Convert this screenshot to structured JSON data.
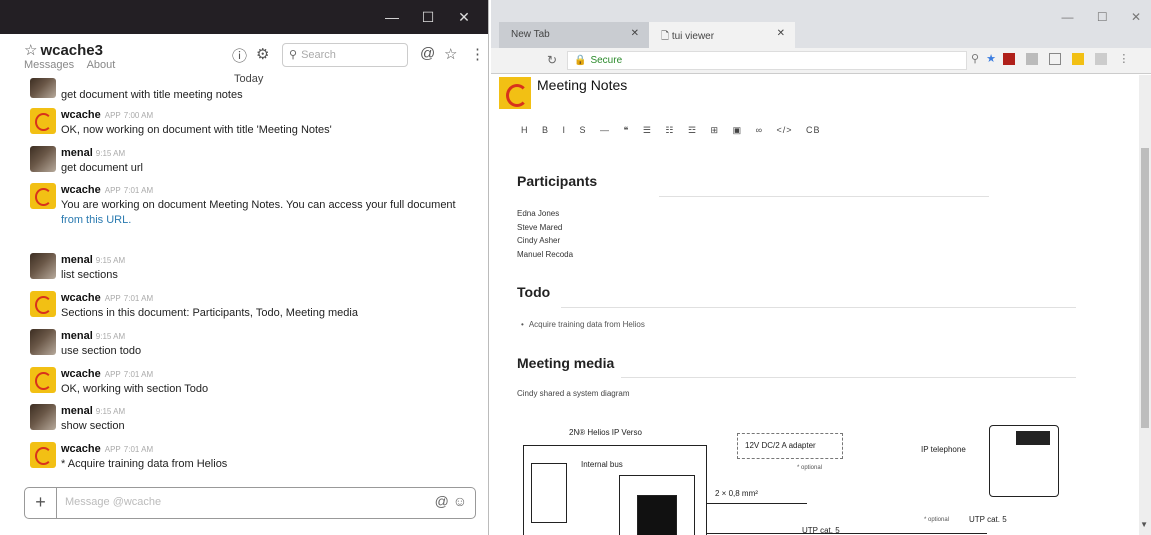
{
  "chat": {
    "channel_name": "wcache3",
    "tabs": [
      "Messages",
      "About"
    ],
    "search_placeholder": "Search",
    "day_divider": "Today",
    "composer_placeholder": "Message @wcache",
    "messages": [
      {
        "kind": "human",
        "name": "",
        "time": "",
        "text": "get document with title meeting notes"
      },
      {
        "kind": "bot",
        "name": "wcache",
        "app": "APP",
        "time": "7:00 AM",
        "text": "OK, now working on document with title 'Meeting Notes'"
      },
      {
        "kind": "human",
        "name": "menal",
        "time": "9:15 AM",
        "text": "get document url"
      },
      {
        "kind": "bot",
        "name": "wcache",
        "app": "APP",
        "time": "7:01 AM",
        "text": "You are working on document Meeting Notes. You can access your full document",
        "link": "from this URL."
      },
      {
        "kind": "human",
        "name": "menal",
        "time": "9:15 AM",
        "text": "list sections"
      },
      {
        "kind": "bot",
        "name": "wcache",
        "app": "APP",
        "time": "7:01 AM",
        "text": "Sections in this document: Participants, Todo, Meeting media"
      },
      {
        "kind": "human",
        "name": "menal",
        "time": "9:15 AM",
        "text": "use section todo"
      },
      {
        "kind": "bot",
        "name": "wcache",
        "app": "APP",
        "time": "7:01 AM",
        "text": "OK, working with section Todo"
      },
      {
        "kind": "human",
        "name": "menal",
        "time": "9:15 AM",
        "text": "show section"
      },
      {
        "kind": "bot",
        "name": "wcache",
        "app": "APP",
        "time": "7:01 AM",
        "text": "* Acquire training data from Helios"
      }
    ]
  },
  "browser": {
    "tabs": [
      {
        "label": "New Tab"
      },
      {
        "label": "tui viewer"
      }
    ],
    "url_label": "Secure",
    "doc": {
      "title": "Meeting Notes",
      "toolbar": "H B I S — ❝ ☰ ☷ ☲ ⊞ ▣ ∞ </> CB",
      "sections": [
        {
          "heading": "Participants",
          "items": [
            "Edna Jones",
            "Steve Mared",
            "Cindy Asher",
            "Manuel Recoda"
          ]
        },
        {
          "heading": "Todo",
          "items": [
            "Acquire training data from Helios"
          ]
        },
        {
          "heading": "Meeting media",
          "items": [
            "Cindy shared a system diagram"
          ]
        }
      ],
      "diagram": {
        "device_label": "2N® Helios IP Verso",
        "internal_bus": "Internal bus",
        "adapter": "12V DC/2 A adapter",
        "optional": "* optional",
        "wire": "2 × 0,8 mm²",
        "ip_phone": "IP telephone",
        "utp1": "UTP cat. 5",
        "utp2": "UTP cat. 5"
      }
    }
  }
}
